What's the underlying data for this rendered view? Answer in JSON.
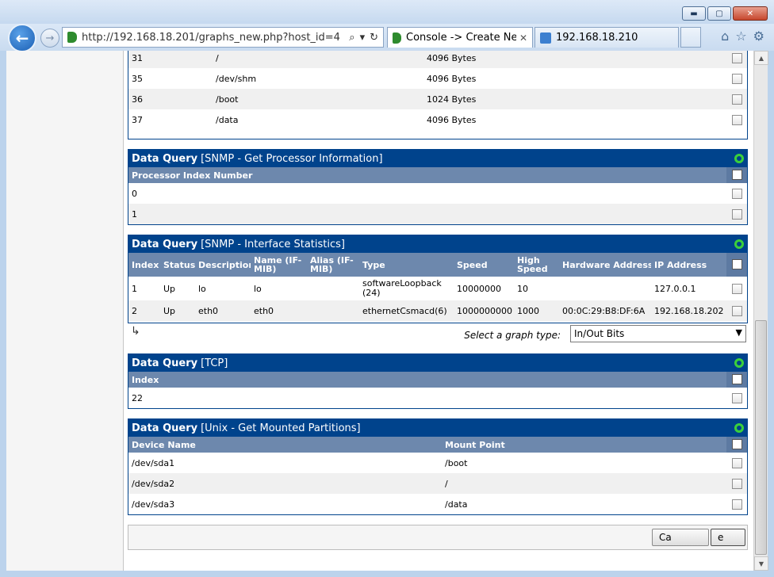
{
  "browser": {
    "url": "http://192.168.18.201/graphs_new.php?host_id=4",
    "tabs": [
      {
        "label": "Console -> Create Ne..."
      },
      {
        "label": "192.168.18.210"
      }
    ]
  },
  "partial_table": {
    "rows": [
      {
        "index": "31",
        "mount": "/",
        "size": "4096 Bytes"
      },
      {
        "index": "35",
        "mount": "/dev/shm",
        "size": "4096 Bytes"
      },
      {
        "index": "36",
        "mount": "/boot",
        "size": "1024 Bytes"
      },
      {
        "index": "37",
        "mount": "/data",
        "size": "4096 Bytes"
      }
    ]
  },
  "processor": {
    "prefix": "Data Query",
    "title": "[SNMP - Get Processor Information]",
    "column": "Processor Index Number",
    "rows": [
      "0",
      "1"
    ]
  },
  "interfaces": {
    "prefix": "Data Query",
    "title": "[SNMP - Interface Statistics]",
    "columns": [
      "Index",
      "Status",
      "Description",
      "Name (IF-MIB)",
      "Alias (IF-MIB)",
      "Type",
      "Speed",
      "High Speed",
      "Hardware Address",
      "IP Address"
    ],
    "rows": [
      [
        "1",
        "Up",
        "lo",
        "lo",
        "",
        "softwareLoopback (24)",
        "10000000",
        "10",
        "",
        "127.0.0.1"
      ],
      [
        "2",
        "Up",
        "eth0",
        "eth0",
        "",
        "ethernetCsmacd(6)",
        "1000000000",
        "1000",
        "00:0C:29:B8:DF:6A",
        "192.168.18.202"
      ]
    ],
    "graph_type_label": "Select a graph type:",
    "graph_type_value": "In/Out Bits"
  },
  "tcp": {
    "prefix": "Data Query",
    "title": "[TCP]",
    "column": "Index",
    "rows": [
      "22"
    ]
  },
  "partitions": {
    "prefix": "Data Query",
    "title": "[Unix - Get Mounted Partitions]",
    "columns": [
      "Device Name",
      "Mount Point"
    ],
    "rows": [
      [
        "/dev/sda1",
        "/boot"
      ],
      [
        "/dev/sda2",
        "/"
      ],
      [
        "/dev/sda3",
        "/data"
      ]
    ]
  },
  "actions": {
    "cancel": "Ca",
    "create": "e"
  },
  "colors": {
    "header_blue": "#00438c",
    "column_header": "#6d88ad",
    "ring_green": "#3bd03b"
  }
}
